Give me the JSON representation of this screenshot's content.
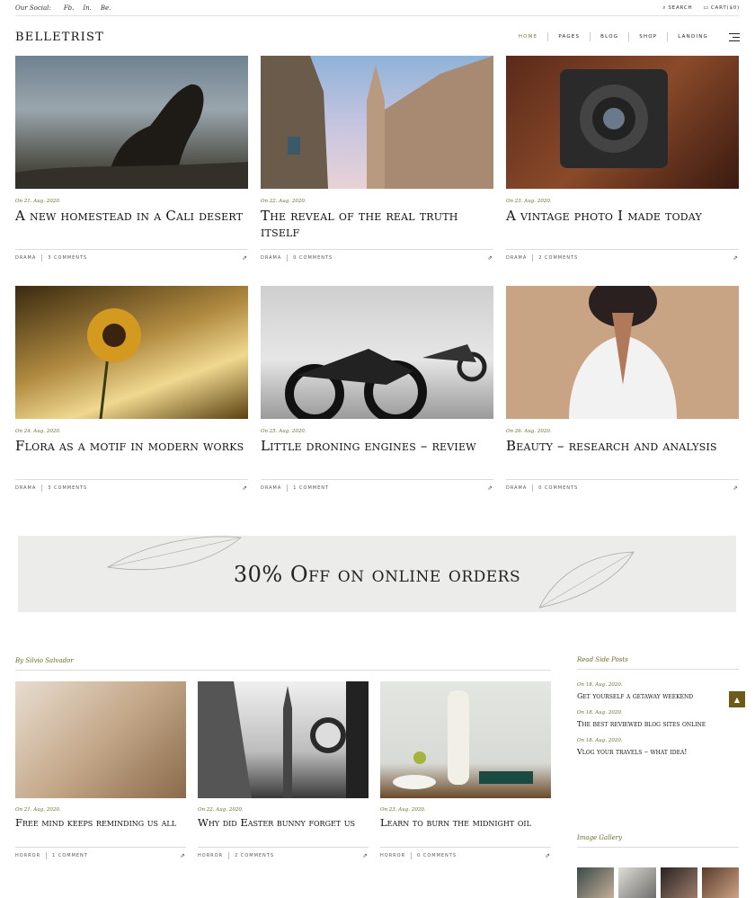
{
  "topbar": {
    "social_label": "Our Social:",
    "social_links": [
      "Fb.",
      "In.",
      "Be."
    ],
    "search_label": "SEARCH",
    "cart_label": "CART($0)"
  },
  "header": {
    "logo": "BELLETRIST",
    "nav": [
      "HOME",
      "PAGES",
      "BLOG",
      "SHOP",
      "LANDING"
    ]
  },
  "posts": [
    {
      "date": "On 21. Aug. 2020.",
      "title": "A new homestead in a Cali desert",
      "category": "DRAMA",
      "comments": "3 COMMENTS"
    },
    {
      "date": "On 22. Aug. 2020.",
      "title": "The reveal of the real truth itself",
      "category": "DRAMA",
      "comments": "0 COMMENTS"
    },
    {
      "date": "On 23. Aug. 2020.",
      "title": "A vintage photo I made today",
      "category": "DRAMA",
      "comments": "2 COMMENTS"
    },
    {
      "date": "On 24. Aug. 2020.",
      "title": "Flora as a motif in modern works",
      "category": "DRAMA",
      "comments": "3 COMMENTS"
    },
    {
      "date": "On 25. Aug. 2020.",
      "title": "Little droning engines – review",
      "category": "DRAMA",
      "comments": "1 COMMENT"
    },
    {
      "date": "On 26. Aug. 2020.",
      "title": "Beauty – research and analysis",
      "category": "DRAMA",
      "comments": "0 COMMENTS"
    }
  ],
  "promo": {
    "text": "30% Off on online orders"
  },
  "author": {
    "label": "By Silvio Salvador"
  },
  "author_posts": [
    {
      "date": "On 21. Aug. 2020.",
      "title": "Free mind keeps reminding us all",
      "category": "HORROR",
      "comments": "1 COMMENT"
    },
    {
      "date": "On 22. Aug. 2020.",
      "title": "Why did Easter bunny forget us",
      "category": "HORROR",
      "comments": "2 COMMENTS"
    },
    {
      "date": "On 23. Aug. 2020.",
      "title": "Learn to burn the midnight oil",
      "category": "HORROR",
      "comments": "0 COMMENTS"
    }
  ],
  "sidebar": {
    "side_posts_heading": "Read Side Posts",
    "side_posts": [
      {
        "date": "On 18. Aug. 2020.",
        "title": "Get yourself a getaway weekend"
      },
      {
        "date": "On 18. Aug. 2020.",
        "title": "The best reviewed blog sites online"
      },
      {
        "date": "On 18. Aug. 2020.",
        "title": "Vlog your travels – what idea!"
      }
    ],
    "gallery_heading": "Image Gallery"
  }
}
